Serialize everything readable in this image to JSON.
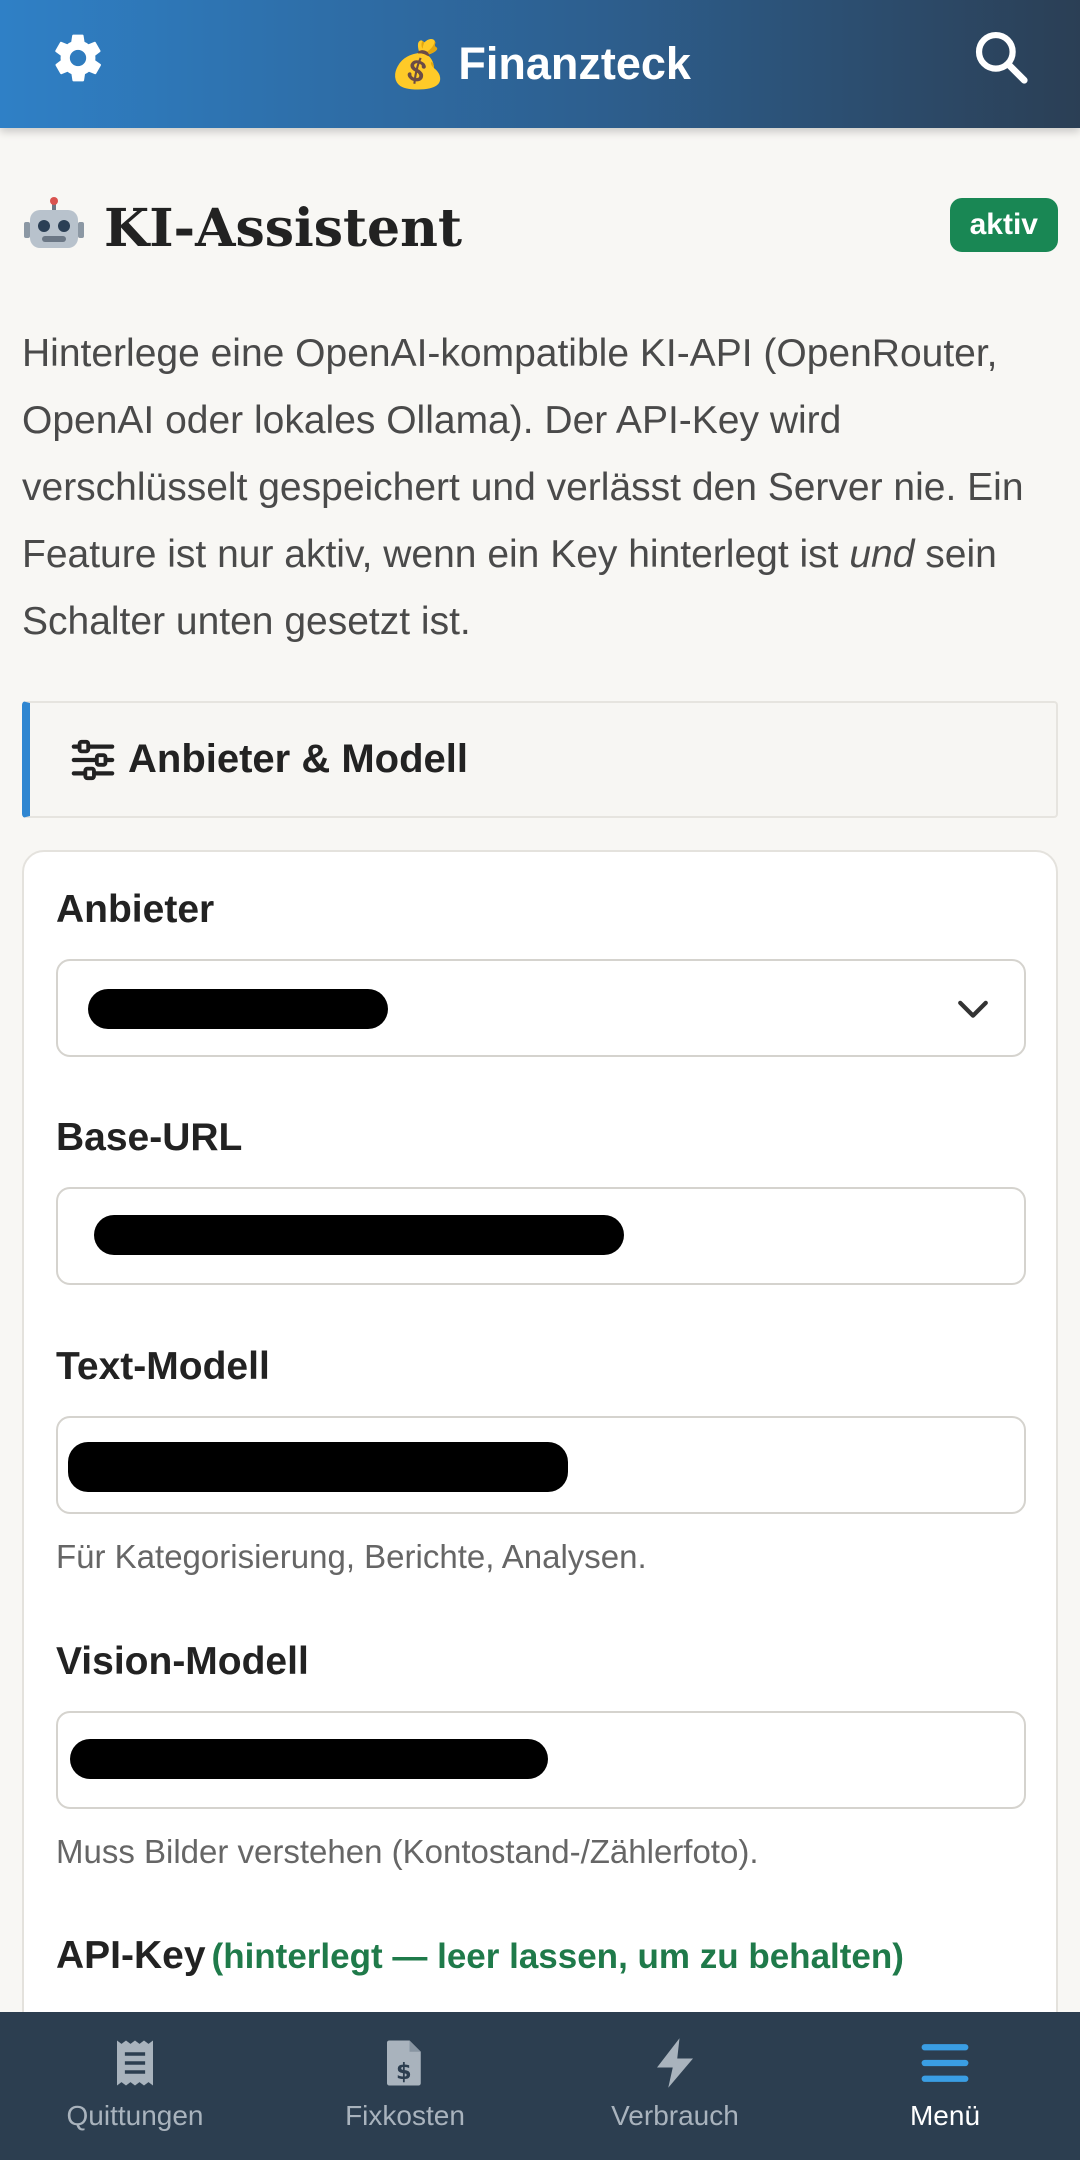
{
  "header": {
    "brand_emoji": "💰",
    "brand_title": "Finanzteck",
    "settings_icon": "gear-icon",
    "search_icon": "search-icon"
  },
  "page": {
    "title": "KI-Assistent",
    "title_icon": "robot-icon",
    "status_badge": "aktiv",
    "status_color": "#198754",
    "description_1": "Hinterlege eine OpenAI-kompatible KI-API (OpenRouter, OpenAI oder lokales Ollama). Der API-Key wird verschlüsselt gespeichert und verlässt den Server nie. Ein Feature ist nur aktiv, wenn ein Key hinterlegt ist ",
    "description_em": "und",
    "description_2": " sein Schalter unten gesetzt ist."
  },
  "section": {
    "title": "Anbieter & Modell",
    "icon": "sliders-icon",
    "accent": "#2f86d1"
  },
  "form": {
    "provider_label": "Anbieter",
    "base_url_label": "Base-URL",
    "text_model_label": "Text-Modell",
    "text_model_help": "Für Kategorisierung, Berichte, Analysen.",
    "vision_model_label": "Vision-Modell",
    "vision_model_help": "Muss Bilder verstehen (Kontostand-/Zählerfoto).",
    "api_key_label": "API-Key",
    "api_key_hint": "(hinterlegt — leer lassen, um zu behalten)"
  },
  "tabs": [
    {
      "label": "Quittungen",
      "icon": "receipt-icon"
    },
    {
      "label": "Fixkosten",
      "icon": "invoice-dollar-icon"
    },
    {
      "label": "Verbrauch",
      "icon": "bolt-icon"
    },
    {
      "label": "Menü",
      "icon": "menu-icon",
      "active": true
    }
  ]
}
